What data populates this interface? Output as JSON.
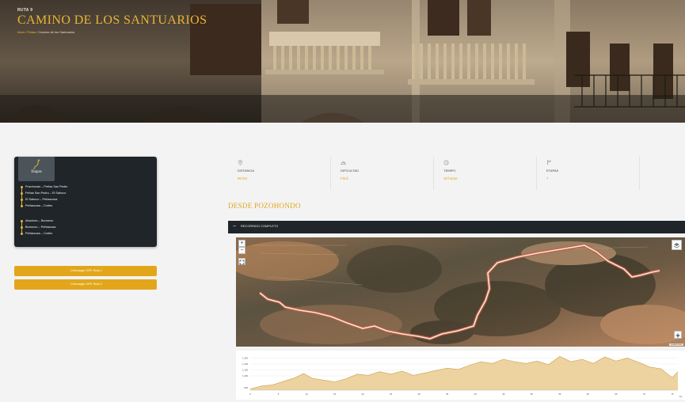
{
  "hero": {
    "route_number": "RUTA 9",
    "title": "CAMINO DE LOS SANTUARIOS",
    "breadcrumb": {
      "home": "Inicio",
      "separator1": " / ",
      "routes": "Rutas",
      "separator2": " / ",
      "current": "Camino de los Santuarios"
    }
  },
  "stages": {
    "tab_label": "Etapas",
    "group1": [
      "Pozohondo – Peñas San Pedro",
      "Peñas San Pedro – El Sahuco",
      "El Sahuco – Peñascosa",
      "Peñascosa – Cortes"
    ],
    "group2": [
      "Alcadozo – Burruezo",
      "Burruezo – Peñascosa",
      "Peñascosa – Cortes"
    ]
  },
  "downloads": {
    "btn1": "↓ Descargar GPX Ruta 1",
    "btn2": "↓ Descargar GPX Ruta 2"
  },
  "stats": [
    {
      "icon": "location-pin-icon",
      "label": "DISTANCIA",
      "value": "90 km"
    },
    {
      "icon": "difficulty-icon",
      "label": "DIFICULTAD",
      "value": "Fácil"
    },
    {
      "icon": "clock-icon",
      "label": "TIEMPO",
      "value": "10 horas"
    },
    {
      "icon": "flag-icon",
      "label": "ETAPAS",
      "value": "7"
    }
  ],
  "section": {
    "title": "DESDE POZOHONDO",
    "toggle_symbol": "−",
    "route_label": "RECORRIDO COMPLETO"
  },
  "map": {
    "zoom_in": "+",
    "zoom_out": "−",
    "attribution": "Leaflet | Esri"
  },
  "chart_data": {
    "type": "area",
    "x_ticks": [
      "0",
      "5",
      "10",
      "15",
      "20",
      "25",
      "30",
      "35",
      "40",
      "45",
      "50",
      "55",
      "60",
      "65",
      "70",
      "75"
    ],
    "x_unit": "km",
    "y_ticks": [
      "800",
      "1,000",
      "1,100",
      "1,200",
      "1,300"
    ],
    "ylim": [
      760,
      1360
    ],
    "x": [
      0,
      2,
      4,
      6,
      8,
      9.5,
      11,
      13,
      15,
      17,
      19,
      21,
      23,
      25,
      27,
      29,
      31,
      33,
      35,
      37,
      39,
      41,
      43,
      45,
      47,
      49,
      51,
      53,
      55,
      57,
      59,
      61,
      63,
      65,
      67,
      69,
      71,
      73,
      75,
      76
    ],
    "y": [
      780,
      830,
      850,
      910,
      970,
      1040,
      960,
      930,
      900,
      950,
      1030,
      1010,
      1070,
      1030,
      1080,
      1010,
      1050,
      1090,
      1130,
      1110,
      1180,
      1240,
      1210,
      1280,
      1240,
      1210,
      1250,
      1190,
      1330,
      1240,
      1280,
      1210,
      1320,
      1250,
      1300,
      1230,
      1150,
      1120,
      970,
      1070
    ],
    "color": "#e8c888",
    "line_color": "#c9a04a"
  },
  "colors": {
    "accent": "#e2a61a",
    "dark_panel": "#1f2529"
  }
}
